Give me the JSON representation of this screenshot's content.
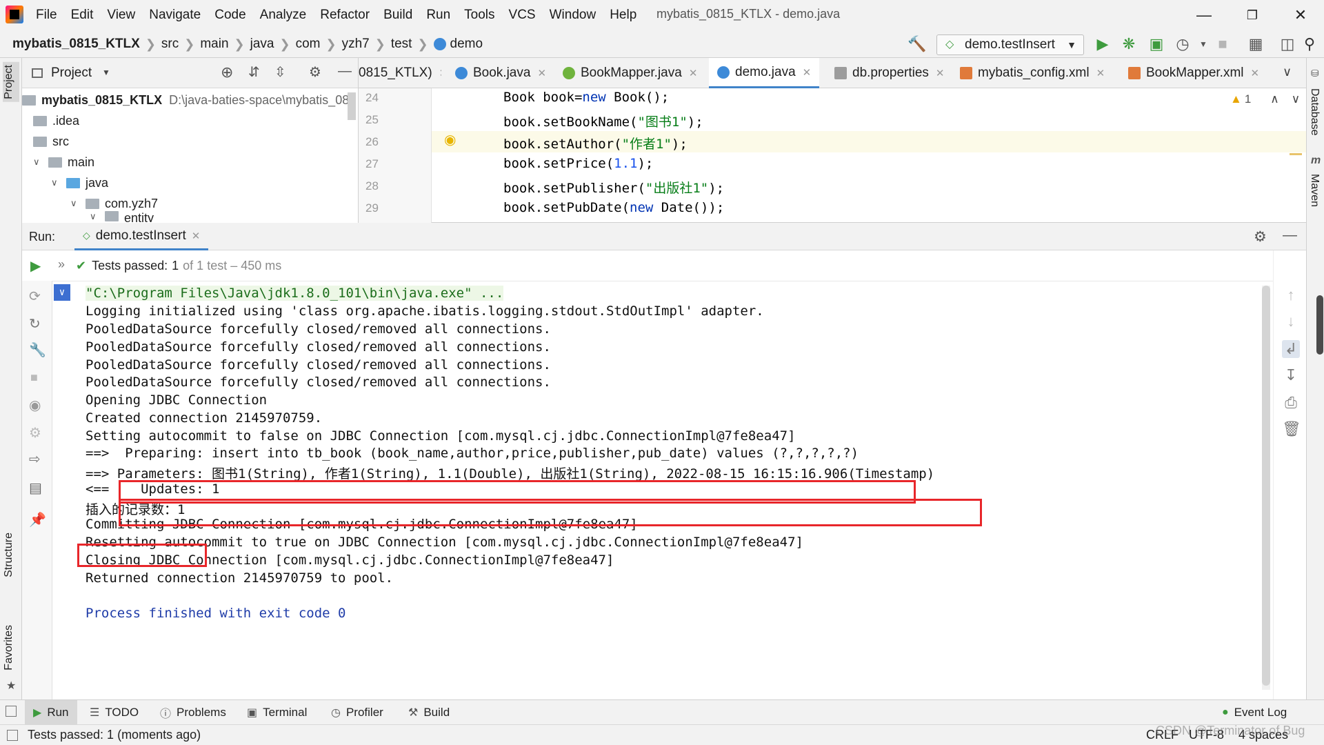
{
  "menubar": {
    "items": [
      "File",
      "Edit",
      "View",
      "Navigate",
      "Code",
      "Analyze",
      "Refactor",
      "Build",
      "Run",
      "Tools",
      "VCS",
      "Window",
      "Help"
    ],
    "window_title": "mybatis_0815_KTLX - demo.java"
  },
  "navbar": {
    "crumbs": [
      "mybatis_0815_KTLX",
      "src",
      "main",
      "java",
      "com",
      "yzh7",
      "test",
      "demo"
    ],
    "run_config": "demo.testInsert"
  },
  "left_stripe": {
    "project": "Project",
    "structure": "Structure",
    "favorites": "Favorites"
  },
  "right_stripe": {
    "database": "Database",
    "maven": "Maven"
  },
  "project_panel": {
    "title": "Project",
    "root_name": "mybatis_0815_KTLX",
    "root_path": "D:\\java-baties-space\\mybatis_08",
    "nodes": [
      ".idea",
      "src",
      "main",
      "java",
      "com.yzh7",
      "entity"
    ]
  },
  "editor_tabs": [
    {
      "label": "0815_KTLX)"
    },
    {
      "label": "Book.java"
    },
    {
      "label": "BookMapper.java"
    },
    {
      "label": "demo.java"
    },
    {
      "label": "db.properties"
    },
    {
      "label": "mybatis_config.xml"
    },
    {
      "label": "BookMapper.xml"
    }
  ],
  "editor": {
    "line_numbers": [
      "24",
      "25",
      "26",
      "27",
      "28",
      "29"
    ],
    "lines": [
      [
        "Book book=",
        "new",
        " Book();"
      ],
      [
        "book.setBookName(",
        "\"图书1\"",
        ");"
      ],
      [
        "book.setAuthor(",
        "\"作者1\"",
        ");"
      ],
      [
        "book.setPrice(",
        "1.1",
        ");"
      ],
      [
        "book.setPublisher(",
        "\"出版社1\"",
        ");"
      ],
      [
        "book.setPubDate(",
        "new",
        " Date());"
      ]
    ],
    "warning_count": "1"
  },
  "run": {
    "label": "Run:",
    "tab": "demo.testInsert",
    "tests_passed_label": "Tests passed:",
    "passed_count": "1",
    "passed_suffix": "of 1 test – 450 ms",
    "console": [
      "\"C:\\Program Files\\Java\\jdk1.8.0_101\\bin\\java.exe\" ...",
      "Logging initialized using 'class org.apache.ibatis.logging.stdout.StdOutImpl' adapter.",
      "PooledDataSource forcefully closed/removed all connections.",
      "PooledDataSource forcefully closed/removed all connections.",
      "PooledDataSource forcefully closed/removed all connections.",
      "PooledDataSource forcefully closed/removed all connections.",
      "Opening JDBC Connection",
      "Created connection 2145970759.",
      "Setting autocommit to false on JDBC Connection [com.mysql.cj.jdbc.ConnectionImpl@7fe8ea47]",
      "==>  Preparing: insert into tb_book (book_name,author,price,publisher,pub_date) values (?,?,?,?,?)",
      "==> Parameters: 图书1(String), 作者1(String), 1.1(Double), 出版社1(String), 2022-08-15 16:15:16.906(Timestamp)",
      "<==    Updates: 1",
      "插入的记录数：1",
      "Committing JDBC Connection [com.mysql.cj.jdbc.ConnectionImpl@7fe8ea47]",
      "Resetting autocommit to true on JDBC Connection [com.mysql.cj.jdbc.ConnectionImpl@7fe8ea47]",
      "Closing JDBC Connection [com.mysql.cj.jdbc.ConnectionImpl@7fe8ea47]",
      "Returned connection 2145970759 to pool.",
      "",
      "Process finished with exit code 0"
    ]
  },
  "tool_windows": [
    "Run",
    "TODO",
    "Problems",
    "Terminal",
    "Profiler",
    "Build"
  ],
  "event_log": "Event Log",
  "status": {
    "message": "Tests passed: 1 (moments ago)",
    "line_sep": "CRLF",
    "encoding": "UTF-8",
    "indent": "4 spaces",
    "watermark": "CSDN @Terminator of Bug"
  },
  "colors": {
    "accent": "#4083c9",
    "highlight_box": "#e8262a",
    "pass_green": "#3e9b3e",
    "keyword": "#0033b3",
    "string": "#067d17"
  }
}
